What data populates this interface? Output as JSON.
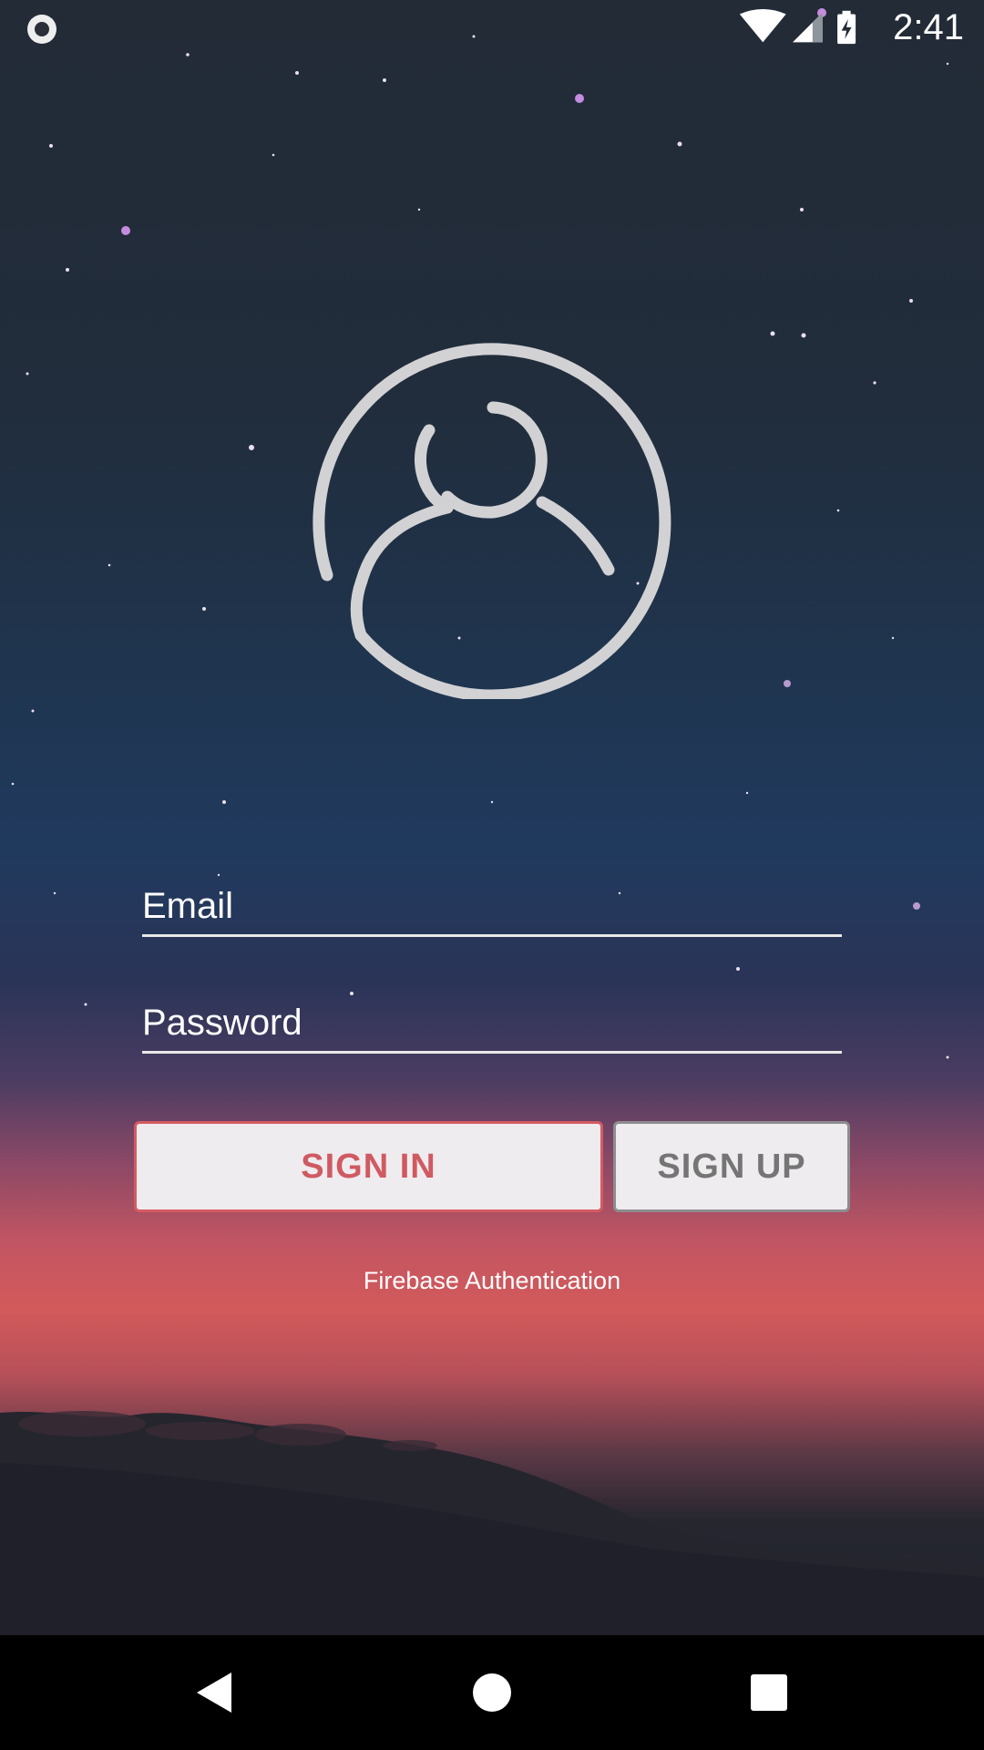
{
  "status_bar": {
    "time": "2:41",
    "icons": [
      "record-indicator-icon",
      "wifi-icon",
      "cell-signal-icon",
      "battery-charging-icon"
    ]
  },
  "login": {
    "avatar_icon": "user-circle-icon",
    "email_placeholder": "Email",
    "password_placeholder": "Password",
    "sign_in_label": "SIGN IN",
    "sign_up_label": "SIGN UP",
    "caption": "Firebase Authentication"
  },
  "nav_bar": {
    "icons": [
      "back-icon",
      "home-icon",
      "recents-icon"
    ]
  },
  "colors": {
    "sign_in_accent": "#cf5a62",
    "sign_up_text": "#757575",
    "button_fill": "#efecef",
    "sky_top": "#222b36",
    "sunset": "#d25a5a"
  }
}
